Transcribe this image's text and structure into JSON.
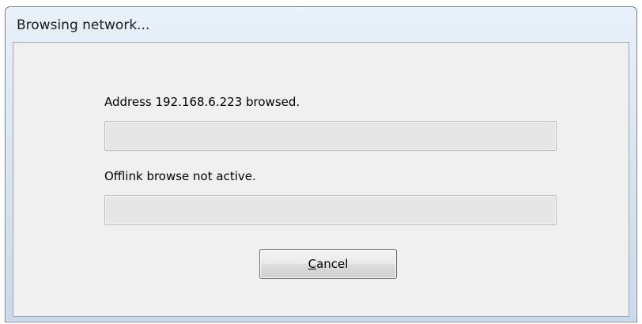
{
  "window": {
    "title": "Browsing network..."
  },
  "status": {
    "address_text": "Address 192.168.6.223 browsed.",
    "offlink_text": "Offlink browse not active."
  },
  "progress": {
    "address_fraction": 0,
    "offlink_fraction": 0,
    "fill_color": "#26b426"
  },
  "buttons": {
    "cancel": {
      "accelerator": "C",
      "label_rest": "ancel"
    }
  }
}
